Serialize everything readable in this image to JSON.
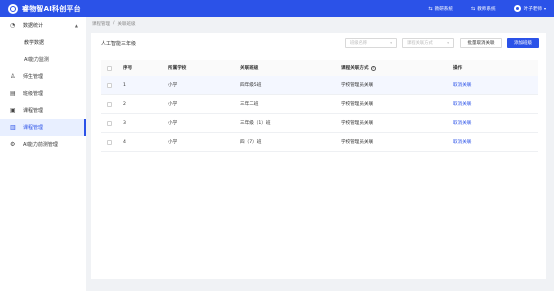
{
  "header": {
    "title": "睿物智AI科创平台",
    "links": [
      {
        "label": "教研系统",
        "icon": "swap-icon"
      },
      {
        "label": "教师系统",
        "icon": "swap-icon"
      }
    ],
    "user": {
      "name": "叶子老师"
    },
    "colors": {
      "primary": "#2b52e8"
    }
  },
  "sidebar": {
    "items": [
      {
        "label": "数据统计",
        "icon": "chart-pie-icon",
        "expanded": true
      },
      {
        "label": "教学数据"
      },
      {
        "label": "AI能力监测"
      },
      {
        "label": "师生管理",
        "icon": "user-icon"
      },
      {
        "label": "班级管理",
        "icon": "class-icon"
      },
      {
        "label": "课程管理",
        "icon": "course-icon"
      },
      {
        "label": "课程管理",
        "icon": "book-icon",
        "active": true
      },
      {
        "label": "AI能力前测管理",
        "icon": "gear-icon"
      }
    ]
  },
  "breadcrumb": {
    "root": "课程管理",
    "sep": "/",
    "current": "关联班级"
  },
  "main": {
    "course_name": "人工智能三年级",
    "filter_grade_placeholder": "班级名称",
    "filter_way_placeholder": "课程关联方式",
    "batch_unlink_label": "批量取消关联",
    "add_class_label": "添加班级"
  },
  "table": {
    "headers": {
      "no": "序号",
      "school": "所属学校",
      "cls": "关联班级",
      "way": "课程关联方式",
      "op": "操作"
    },
    "rows": [
      {
        "no": "1",
        "school": "小学",
        "cls": "四年级5班",
        "way": "学校管理员关联",
        "op": "取消关联"
      },
      {
        "no": "2",
        "school": "小学",
        "cls": "三年二班",
        "way": "学校管理员关联",
        "op": "取消关联"
      },
      {
        "no": "3",
        "school": "小学",
        "cls": "三年级（1）班",
        "way": "学校管理员关联",
        "op": "取消关联"
      },
      {
        "no": "4",
        "school": "小学",
        "cls": "四（7）班",
        "way": "学校管理员关联",
        "op": "取消关联"
      }
    ]
  }
}
